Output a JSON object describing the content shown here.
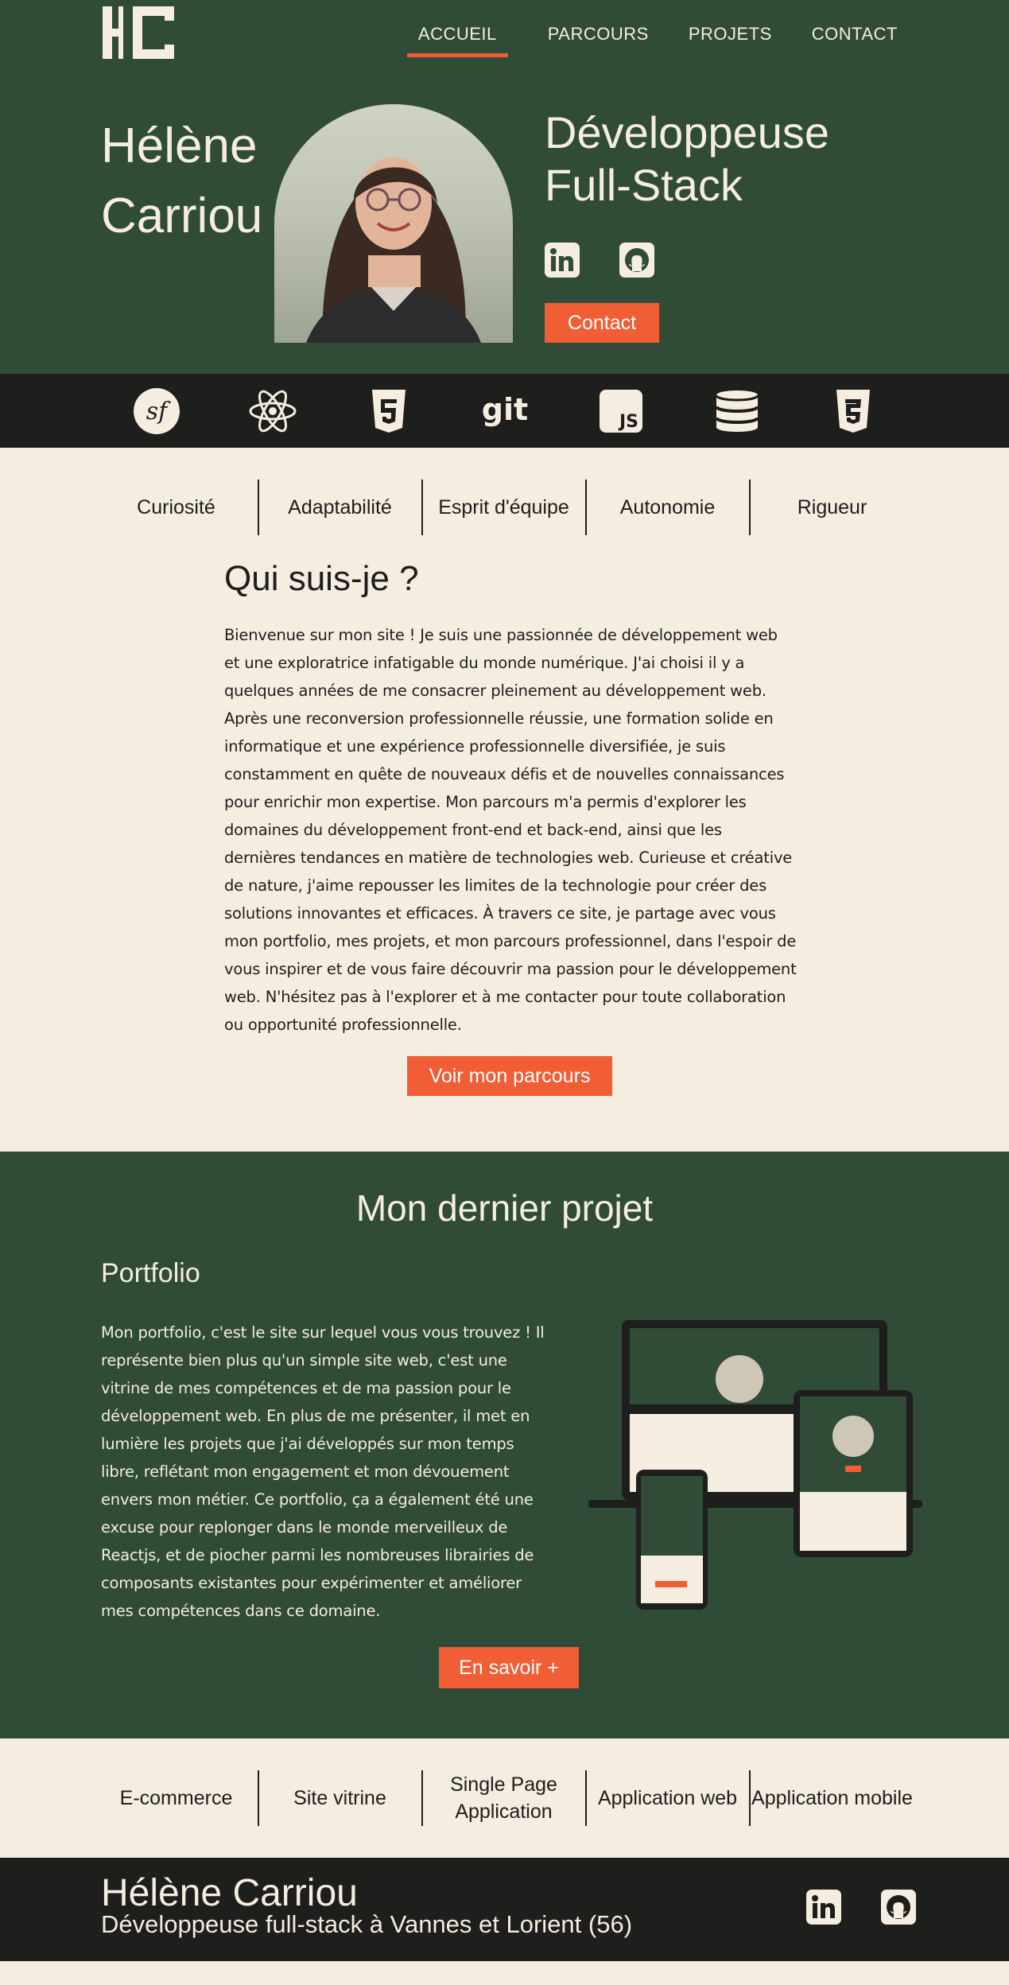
{
  "header": {
    "logo": "HC",
    "nav": [
      {
        "label": "ACCUEIL",
        "active": true
      },
      {
        "label": "PARCOURS",
        "active": false
      },
      {
        "label": "PROJETS",
        "active": false
      },
      {
        "label": "CONTACT",
        "active": false
      }
    ]
  },
  "hero": {
    "first_name": "Hélène",
    "last_name": "Carriou",
    "title_line1": "Développeuse",
    "title_line2": "Full-Stack",
    "social": [
      "linkedin-icon",
      "github-icon"
    ],
    "contact_label": "Contact"
  },
  "tech": [
    "symfony-icon",
    "react-icon",
    "html5-icon",
    "git-icon",
    "javascript-icon",
    "database-icon",
    "css3-icon"
  ],
  "tech_labels": {
    "git": "git",
    "js": "JS"
  },
  "qualities": [
    "Curiosité",
    "Adaptabilité",
    "Esprit d'équipe",
    "Autonomie",
    "Rigueur"
  ],
  "about": {
    "title": "Qui suis-je ?",
    "text": "Bienvenue sur mon site ! Je suis une passionnée de développement web et une exploratrice infatigable du monde numérique. J'ai choisi il y a quelques années de me consacrer pleinement au développement web. Après une reconversion professionnelle réussie, une formation solide en informatique et une expérience professionnelle diversifiée, je suis constamment en quête de nouveaux défis et de nouvelles connaissances pour enrichir mon expertise. Mon parcours m'a permis d'explorer les domaines du développement front-end et back-end, ainsi que les dernières tendances en matière de technologies web. Curieuse et créative de nature, j'aime repousser les limites de la technologie pour créer des solutions innovantes et efficaces. À travers ce site, je partage avec vous mon portfolio, mes projets, et mon parcours professionnel, dans l'espoir de vous inspirer et de vous faire découvrir ma passion pour le développement web. N'hésitez pas à l'explorer et à me contacter pour toute collaboration ou opportunité professionnelle.",
    "button_label": "Voir mon parcours"
  },
  "project": {
    "section_title": "Mon dernier projet",
    "name": "Portfolio",
    "text": "Mon portfolio, c'est le site sur lequel vous vous trouvez ! Il représente bien plus qu'un simple site web, c'est une vitrine de mes compétences et de ma passion pour le développement web. En plus de me présenter, il met en lumière les projets que j'ai développés sur mon temps libre, reflétant mon engagement et mon dévouement envers mon métier. Ce portfolio, ça a également été une excuse pour replonger dans le monde merveilleux de Reactjs, et de piocher parmi les nombreuses librairies de composants existantes pour expérimenter et améliorer mes compétences dans ce domaine.",
    "button_label": "En savoir +"
  },
  "services": [
    {
      "line1": "E-commerce",
      "line2": ""
    },
    {
      "line1": "Site vitrine",
      "line2": ""
    },
    {
      "line1": "Single Page",
      "line2": "Application"
    },
    {
      "line1": "Application web",
      "line2": ""
    },
    {
      "line1": "Application mobile",
      "line2": ""
    }
  ],
  "footer": {
    "name": "Hélène Carriou",
    "tagline": "Développeuse full-stack à Vannes et Lorient (56)"
  },
  "colors": {
    "green": "#304b36",
    "cream": "#f5ede0",
    "dark": "#1e1e1c",
    "accent": "#f15d35"
  }
}
